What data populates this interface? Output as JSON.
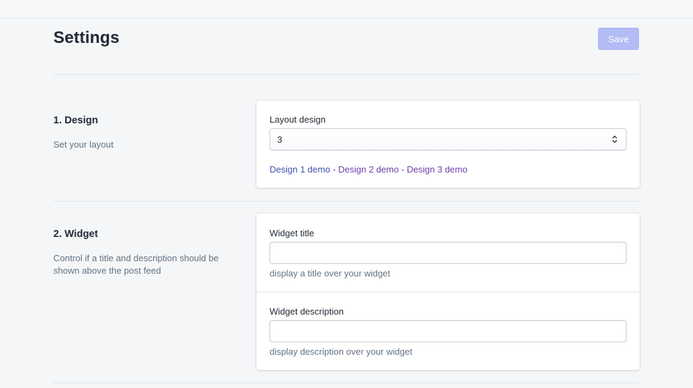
{
  "page": {
    "title": "Settings",
    "save_label": "Save"
  },
  "sections": {
    "design": {
      "title": "1. Design",
      "description": "Set your layout",
      "layout_label": "Layout design",
      "layout_value": "3",
      "demo_links": [
        "Design 1 demo",
        "Design 2 demo",
        "Design 3 demo"
      ],
      "separator": " - "
    },
    "widget": {
      "title": "2. Widget",
      "description": "Control if a title and description should be shown above the post feed",
      "title_label": "Widget title",
      "title_value": "",
      "title_help": "display a title over your widget",
      "desc_label": "Widget description",
      "desc_value": "",
      "desc_help": "display description over your widget"
    }
  },
  "colors": {
    "primary_disabled": "#b3bcf5",
    "link": "#3f4eae",
    "link_visited": "#6f3fa8",
    "background": "#f4f6f8"
  },
  "icons": {
    "select_arrows": "updown-chevron-icon"
  }
}
